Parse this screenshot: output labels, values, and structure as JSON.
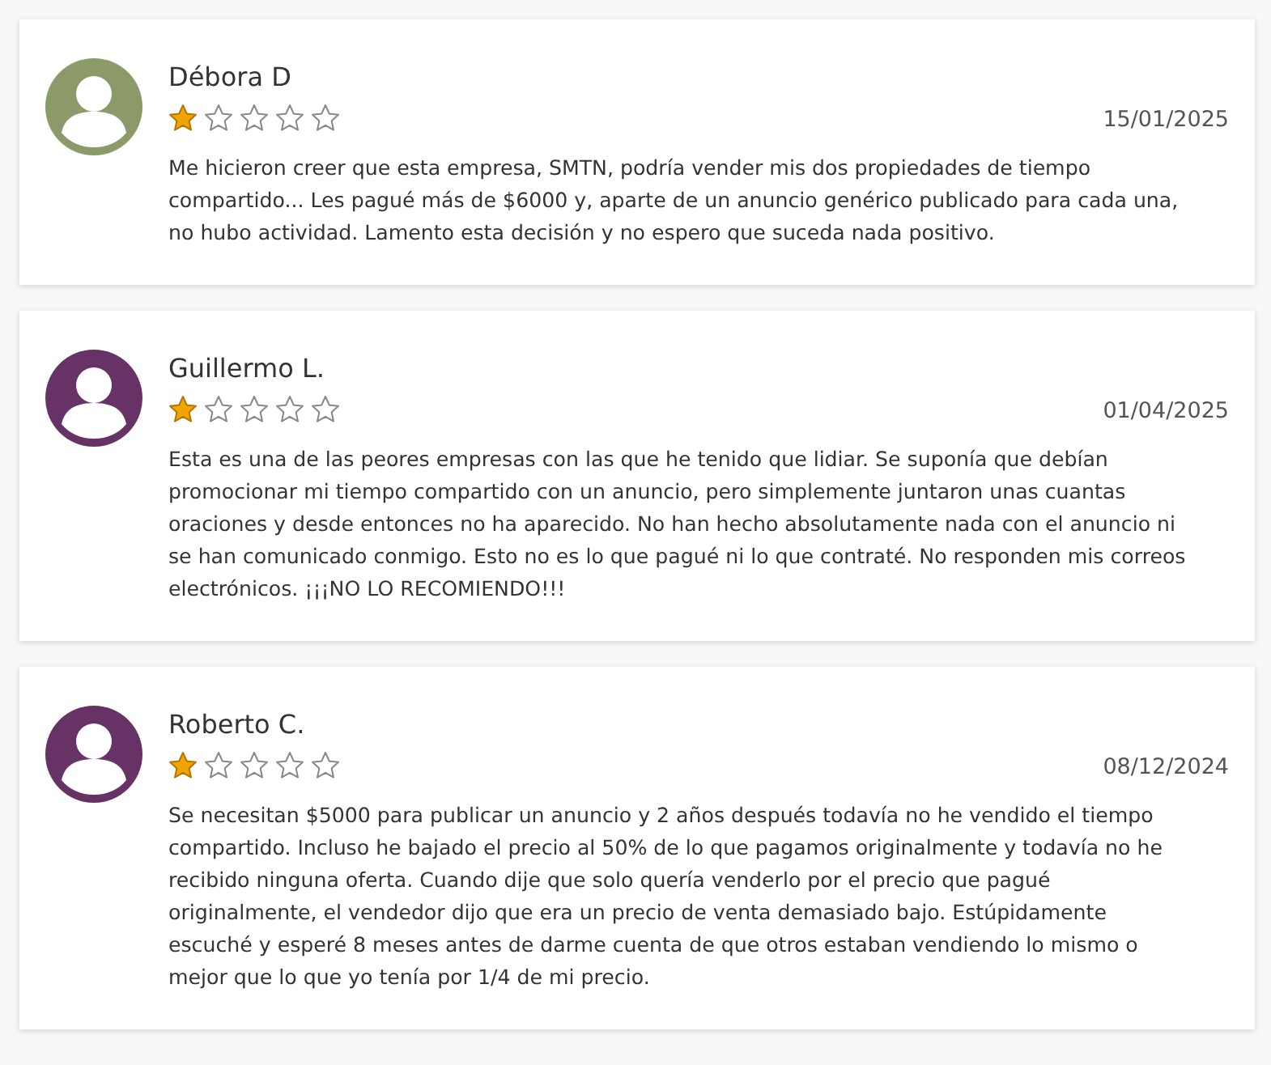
{
  "reviews": [
    {
      "name": "Débora D",
      "color": "#8c9a6a",
      "stars": 1,
      "date": "15/01/2025",
      "text": "Me hicieron creer que esta empresa, SMTN, podría vender mis dos propiedades de tiempo compartido... Les pagué más de $6000 y, aparte de un anuncio genérico publicado para cada una, no hubo actividad. Lamento esta decisión y no espero que suceda nada positivo."
    },
    {
      "name": "Guillermo L.",
      "color": "#673266",
      "stars": 1,
      "date": "01/04/2025",
      "text": "Esta es una de las peores empresas con las que he tenido que lidiar. Se suponía que debían promocionar mi tiempo compartido con un anuncio, pero simplemente juntaron unas cuantas oraciones y desde entonces no ha aparecido. No han hecho absolutamente nada con el anuncio ni se han comunicado conmigo. Esto no es lo que pagué ni lo que contraté. No responden mis correos electrónicos. ¡¡¡NO LO RECOMIENDO!!!"
    },
    {
      "name": "Roberto C.",
      "color": "#673266",
      "stars": 1,
      "date": "08/12/2024",
      "text": "Se necesitan $5000 para publicar un anuncio y 2 años después todavía no he vendido el tiempo compartido. Incluso he bajado el precio al 50% de lo que pagamos originalmente y todavía no he recibido ninguna oferta. Cuando dije que solo quería venderlo por el precio que pagué originalmente, el vendedor dijo que era un precio de venta demasiado bajo. Estúpidamente escuché y esperé 8 meses antes de darme cuenta de que otros estaban vendiendo lo mismo o mejor que lo que yo tenía por 1/4 de mi precio."
    }
  ]
}
